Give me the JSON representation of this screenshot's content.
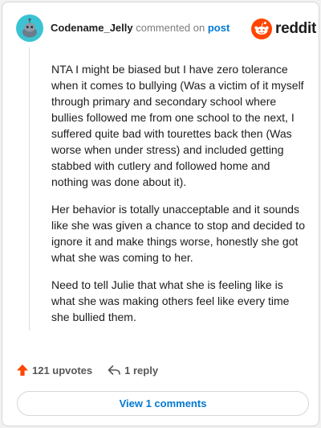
{
  "comment": {
    "username": "Codename_Jelly",
    "action_text": "commented on",
    "post_link": "post",
    "paragraphs": [
      "NTA I might be biased but I have zero tolerance when it comes to bullying (Was a victim of it myself through primary and secondary school where bullies followed me from one school to the next, I suffered quite bad with tourettes back then (Was worse when under stress) and included getting stabbed with cutlery and followed home and nothing was done about it).",
      "Her behavior is totally unacceptable and it sounds like she was given a chance to stop and decided to ignore it and make things worse, honestly she got what she was coming to her.",
      "Need to tell Julie that what she is feeling like is what she was making others feel like every time she bullied them."
    ]
  },
  "brand": {
    "name": "reddit",
    "color": "#ff4500"
  },
  "actions": {
    "upvotes": "121 upvotes",
    "replies": "1 reply"
  },
  "view_comments_label": "View 1 comments",
  "colors": {
    "accent_link": "#0079d3",
    "upvote": "#ff4500",
    "avatar_bg": "#3bc3d4"
  },
  "icons": {
    "avatar": "snoo-avatar-icon",
    "logo": "reddit-snoo-icon",
    "upvote": "upvote-arrow-icon",
    "reply": "reply-arrow-icon"
  }
}
